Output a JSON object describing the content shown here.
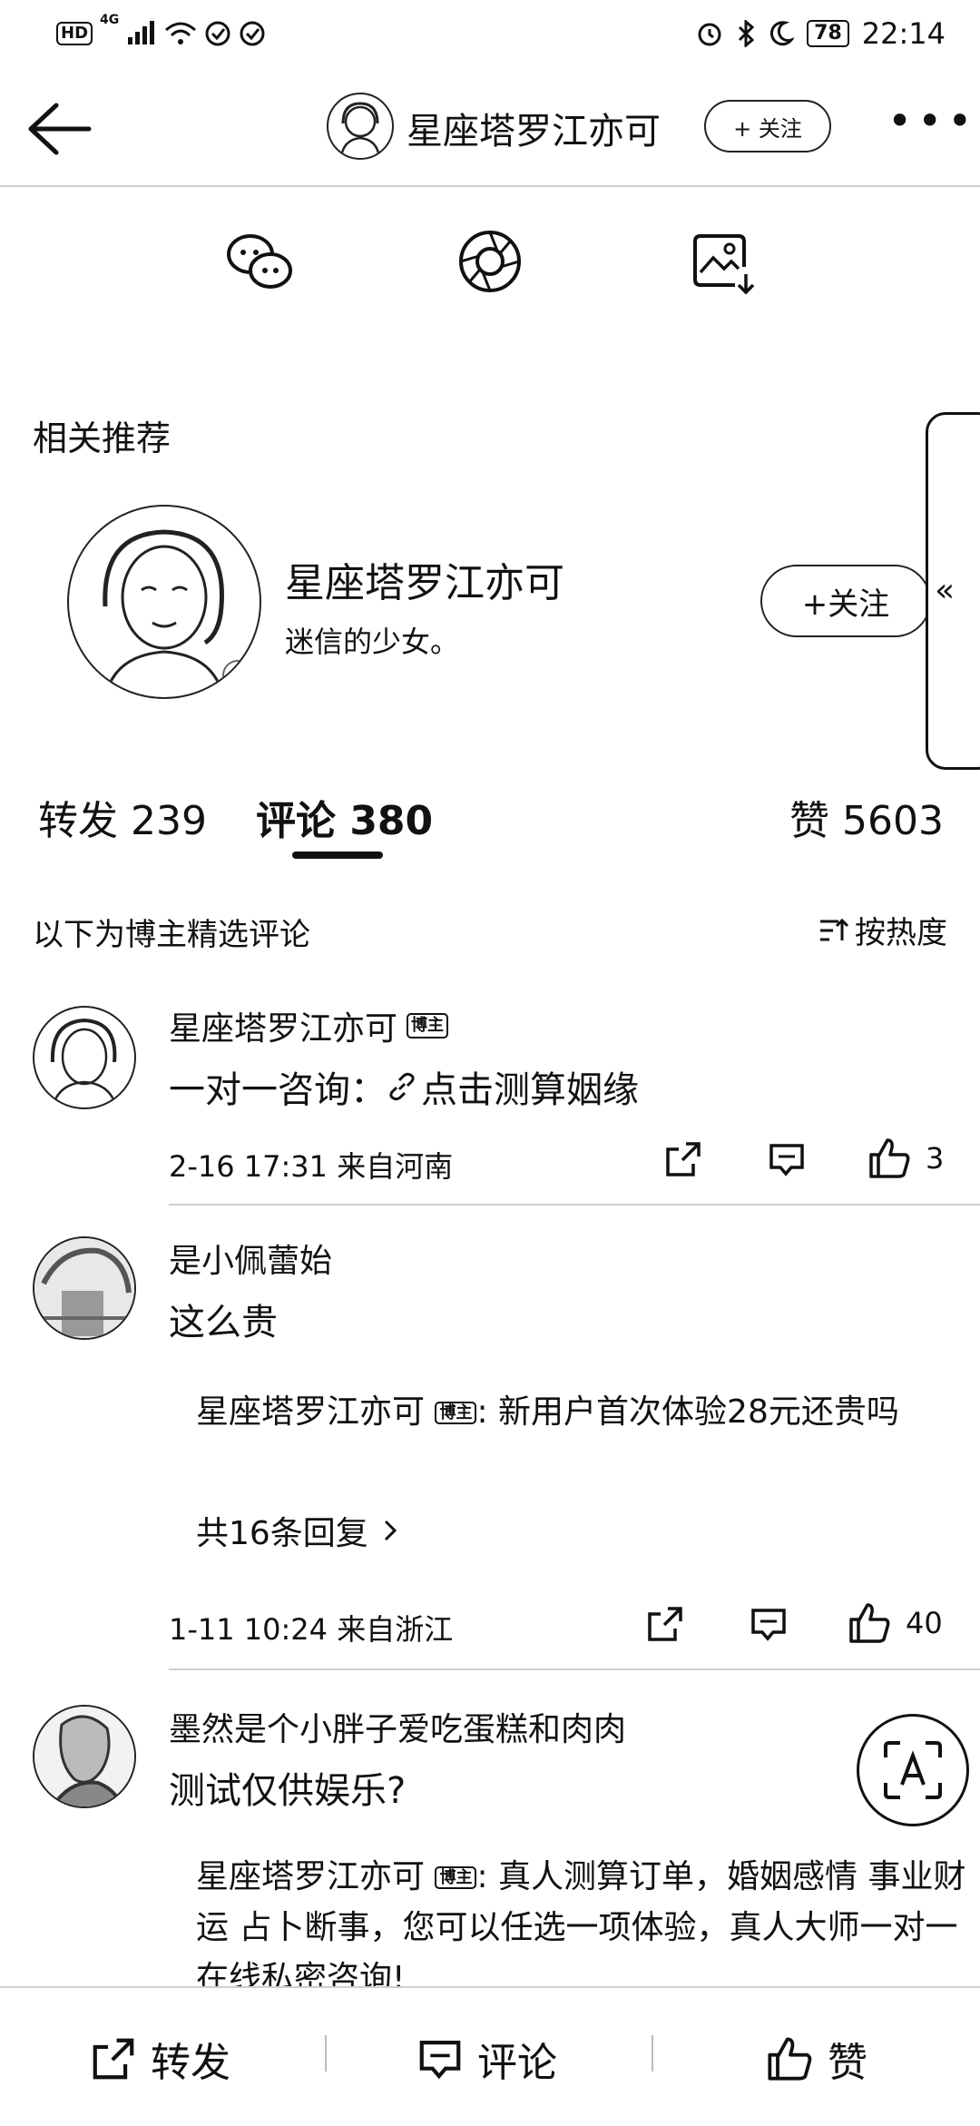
{
  "status_bar": {
    "hd_label": "HD",
    "network": "4G",
    "battery": "78",
    "time": "22:14"
  },
  "header": {
    "title": "星座塔罗江亦可",
    "follow_label": "+ 关注",
    "more_label": "•••"
  },
  "share_row": {
    "icons": [
      "wechat-icon",
      "moments-icon",
      "save-image-icon"
    ]
  },
  "recommend": {
    "section_title": "相关推荐",
    "name": "星座塔罗江亦可",
    "desc": "迷信的少女。",
    "follow_label": "+关注",
    "side_chevron": "«"
  },
  "tabs": {
    "repost": "转发 239",
    "comments": "评论 380",
    "likes": "赞 5603"
  },
  "filter": {
    "note": "以下为博主精选评论",
    "sort_label": "按热度"
  },
  "badge_label": "博主",
  "comments": [
    {
      "name": "星座塔罗江亦可",
      "text": "一对一咨询：",
      "link_text": "点击测算姻缘",
      "time": "2-16 17:31",
      "location": "来自河南",
      "likes": "3"
    },
    {
      "name": "是小佩蕾始",
      "text": "这么贵",
      "reply_author": "星座塔罗江亦可",
      "reply_text": ": 新用户首次体验28元还贵吗",
      "reply_count": "共16条回复",
      "time": "1-11 10:24",
      "location": "来自浙江",
      "likes": "40"
    },
    {
      "name": "墨然是个小胖子爱吃蛋糕和肉肉",
      "text": "测试仅供娱乐?",
      "reply_author": "星座塔罗江亦可",
      "reply_text": ": 真人测算订单，婚姻感情  事业财运  占卜断事，您可以任选一项体验，真人大师一对一在线私密咨询!"
    }
  ],
  "bottom_bar": {
    "repost": "转发",
    "comment": "评论",
    "like": "赞"
  }
}
